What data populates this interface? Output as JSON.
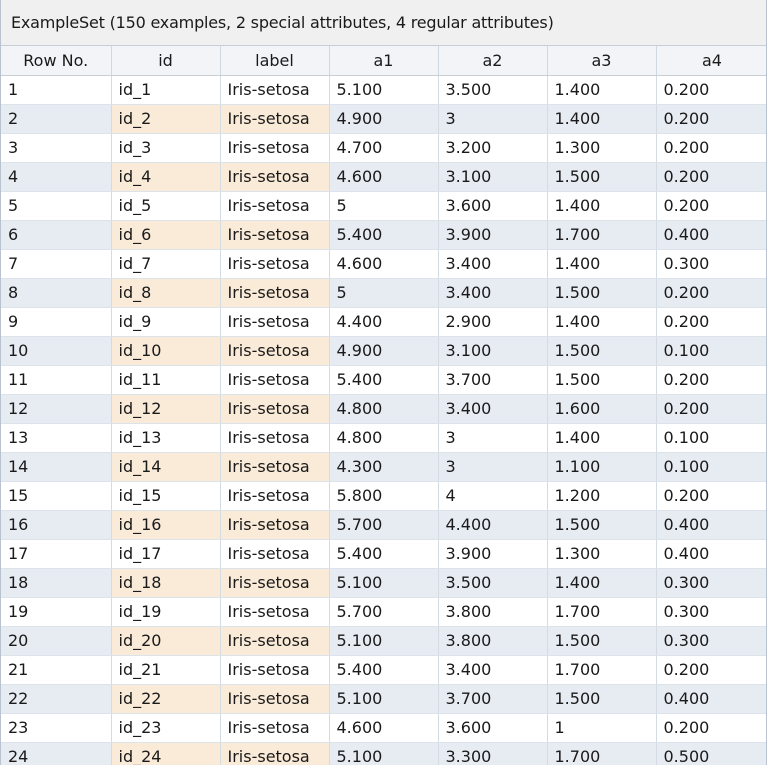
{
  "title": "ExampleSet (150 examples, 2 special attributes, 4 regular attributes)",
  "columns": [
    "Row No.",
    "id",
    "label",
    "a1",
    "a2",
    "a3",
    "a4"
  ],
  "rows": [
    [
      "1",
      "id_1",
      "Iris-setosa",
      "5.100",
      "3.500",
      "1.400",
      "0.200"
    ],
    [
      "2",
      "id_2",
      "Iris-setosa",
      "4.900",
      "3",
      "1.400",
      "0.200"
    ],
    [
      "3",
      "id_3",
      "Iris-setosa",
      "4.700",
      "3.200",
      "1.300",
      "0.200"
    ],
    [
      "4",
      "id_4",
      "Iris-setosa",
      "4.600",
      "3.100",
      "1.500",
      "0.200"
    ],
    [
      "5",
      "id_5",
      "Iris-setosa",
      "5",
      "3.600",
      "1.400",
      "0.200"
    ],
    [
      "6",
      "id_6",
      "Iris-setosa",
      "5.400",
      "3.900",
      "1.700",
      "0.400"
    ],
    [
      "7",
      "id_7",
      "Iris-setosa",
      "4.600",
      "3.400",
      "1.400",
      "0.300"
    ],
    [
      "8",
      "id_8",
      "Iris-setosa",
      "5",
      "3.400",
      "1.500",
      "0.200"
    ],
    [
      "9",
      "id_9",
      "Iris-setosa",
      "4.400",
      "2.900",
      "1.400",
      "0.200"
    ],
    [
      "10",
      "id_10",
      "Iris-setosa",
      "4.900",
      "3.100",
      "1.500",
      "0.100"
    ],
    [
      "11",
      "id_11",
      "Iris-setosa",
      "5.400",
      "3.700",
      "1.500",
      "0.200"
    ],
    [
      "12",
      "id_12",
      "Iris-setosa",
      "4.800",
      "3.400",
      "1.600",
      "0.200"
    ],
    [
      "13",
      "id_13",
      "Iris-setosa",
      "4.800",
      "3",
      "1.400",
      "0.100"
    ],
    [
      "14",
      "id_14",
      "Iris-setosa",
      "4.300",
      "3",
      "1.100",
      "0.100"
    ],
    [
      "15",
      "id_15",
      "Iris-setosa",
      "5.800",
      "4",
      "1.200",
      "0.200"
    ],
    [
      "16",
      "id_16",
      "Iris-setosa",
      "5.700",
      "4.400",
      "1.500",
      "0.400"
    ],
    [
      "17",
      "id_17",
      "Iris-setosa",
      "5.400",
      "3.900",
      "1.300",
      "0.400"
    ],
    [
      "18",
      "id_18",
      "Iris-setosa",
      "5.100",
      "3.500",
      "1.400",
      "0.300"
    ],
    [
      "19",
      "id_19",
      "Iris-setosa",
      "5.700",
      "3.800",
      "1.700",
      "0.300"
    ],
    [
      "20",
      "id_20",
      "Iris-setosa",
      "5.100",
      "3.800",
      "1.500",
      "0.300"
    ],
    [
      "21",
      "id_21",
      "Iris-setosa",
      "5.400",
      "3.400",
      "1.700",
      "0.200"
    ],
    [
      "22",
      "id_22",
      "Iris-setosa",
      "5.100",
      "3.700",
      "1.500",
      "0.400"
    ],
    [
      "23",
      "id_23",
      "Iris-setosa",
      "4.600",
      "3.600",
      "1",
      "0.200"
    ],
    [
      "24",
      "id_24",
      "Iris-setosa",
      "5.100",
      "3.300",
      "1.700",
      "0.500"
    ]
  ],
  "colors": {
    "row_even": "#e7ebf2",
    "row_odd": "#ffffff",
    "special_even": "#faebd9",
    "header_bg": "#f2f4f7",
    "title_bg": "#f0f0f0"
  }
}
